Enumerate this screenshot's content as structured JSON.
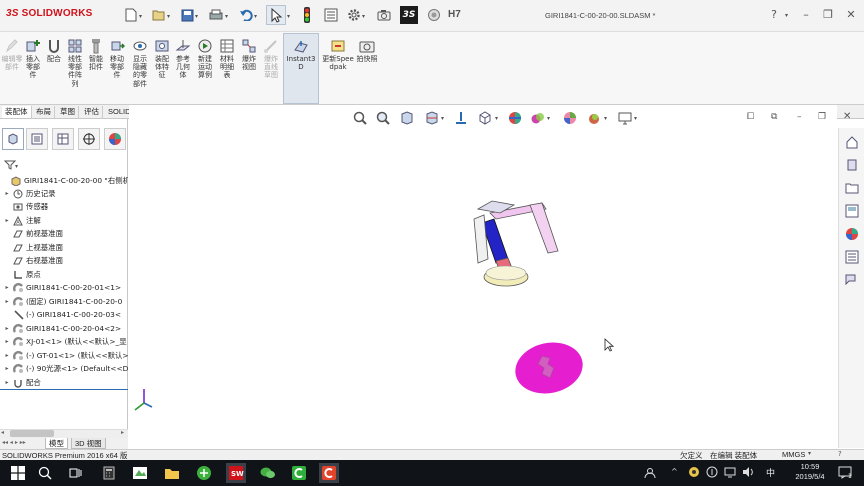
{
  "app": {
    "brand": "SOLIDWORKS",
    "brand_prefix": "3S",
    "filename": "GIRI1841-C-00-20-00.SLDASM *",
    "toolbar_badge": "H7",
    "help_icon": "question-icon",
    "brand_color": "#d0121b"
  },
  "ribbon": {
    "buttons": [
      {
        "label": "编辑零部件",
        "icon": "edit-component-icon",
        "enabled": false
      },
      {
        "label": "插入零部件",
        "icon": "insert-component-icon",
        "enabled": true
      },
      {
        "label": "配合",
        "icon": "mate-icon",
        "enabled": true
      },
      {
        "label": "线性零部件阵列",
        "icon": "linear-pattern-icon",
        "enabled": true
      },
      {
        "label": "智能扣件",
        "icon": "smart-fastener-icon",
        "enabled": true
      },
      {
        "label": "移动零部件",
        "icon": "move-component-icon",
        "enabled": true
      },
      {
        "label": "显示隐藏的零部件",
        "icon": "show-hidden-icon",
        "enabled": true
      },
      {
        "label": "装配体特征",
        "icon": "assembly-feature-icon",
        "enabled": true
      },
      {
        "label": "参考几何体",
        "icon": "reference-geometry-icon",
        "enabled": true
      },
      {
        "label": "新建运动算例",
        "icon": "motion-study-icon",
        "enabled": true
      },
      {
        "label": "材料明细表",
        "icon": "bom-icon",
        "enabled": true
      },
      {
        "label": "爆炸视图",
        "icon": "exploded-view-icon",
        "enabled": true
      },
      {
        "label": "爆炸直线草图",
        "icon": "explode-line-sketch-icon",
        "enabled": false
      },
      {
        "label": "Instant3D",
        "icon": "instant3d-icon",
        "enabled": true
      },
      {
        "label": "更新Speedpak",
        "icon": "speedpak-icon",
        "enabled": true
      },
      {
        "label": "拍快照",
        "icon": "snapshot-icon",
        "enabled": true
      }
    ]
  },
  "command_tabs": [
    "装配体",
    "布局",
    "草图",
    "评估",
    "SOLIDWORKS MBD"
  ],
  "tree": {
    "root": "GIRI1841-C-00-20-00 \"右侧机认",
    "items": [
      {
        "label": "历史记录",
        "icon": "history-icon",
        "expandable": true
      },
      {
        "label": "传感器",
        "icon": "sensor-icon",
        "expandable": false
      },
      {
        "label": "注解",
        "icon": "annotation-icon",
        "expandable": true
      },
      {
        "label": "前视基准面",
        "icon": "plane-icon",
        "expandable": false
      },
      {
        "label": "上视基准面",
        "icon": "plane-icon",
        "expandable": false
      },
      {
        "label": "右视基准面",
        "icon": "plane-icon",
        "expandable": false
      },
      {
        "label": "原点",
        "icon": "origin-icon",
        "expandable": false
      },
      {
        "label": "GIRI1841-C-00-20-01<1>",
        "icon": "part-icon",
        "expandable": true
      },
      {
        "label": "(固定) GIRI1841-C-00-20-0",
        "icon": "part-icon",
        "expandable": true
      },
      {
        "label": "(-) GIRI1841-C-00-20-03<",
        "icon": "part-icon",
        "expandable": true
      },
      {
        "label": "GIRI1841-C-00-20-04<2>",
        "icon": "part-icon",
        "expandable": true
      },
      {
        "label": "XJ-01<1> (默认<<默认>_显",
        "icon": "part-icon",
        "expandable": true
      },
      {
        "label": "(-) GT-01<1> (默认<<默认>",
        "icon": "part-icon",
        "expandable": true
      },
      {
        "label": "(-) 90光源<1> (Default<<D",
        "icon": "part-icon",
        "expandable": true
      },
      {
        "label": "配合",
        "icon": "mates-folder-icon",
        "expandable": true
      }
    ]
  },
  "bottom_tabs": [
    "模型",
    "3D 视图"
  ],
  "status": {
    "product": "SOLIDWORKS Premium 2016 x64 版",
    "defined": "欠定义",
    "editing": "在编辑 装配体",
    "units": "MMGS"
  },
  "taskbar": {
    "time": "10:59",
    "date": "2019/5/4",
    "ime": "中"
  },
  "model_colors": {
    "accent": "#e51fd0",
    "blue_part": "#2424c8",
    "pink_part": "#f2c8f0",
    "cream_base": "#f2ecb8"
  }
}
